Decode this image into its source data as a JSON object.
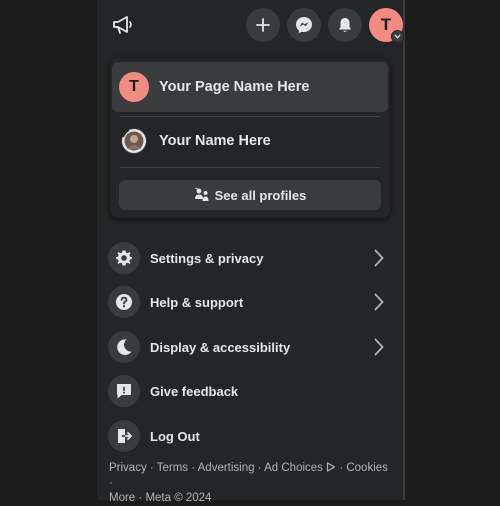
{
  "topbar": {
    "avatar_initial": "T"
  },
  "profiles": {
    "active": {
      "initial": "T",
      "name": "Your Page Name Here"
    },
    "second": {
      "name": "Your Name Here"
    },
    "see_all_label": "See all profiles"
  },
  "menu": {
    "items": [
      {
        "label": "Settings & privacy",
        "icon": "gear-icon",
        "has_chevron": true
      },
      {
        "label": "Help & support",
        "icon": "question-icon",
        "has_chevron": true
      },
      {
        "label": "Display & accessibility",
        "icon": "moon-icon",
        "has_chevron": true
      },
      {
        "label": "Give feedback",
        "icon": "feedback-icon",
        "has_chevron": false
      },
      {
        "label": "Log Out",
        "icon": "logout-icon",
        "has_chevron": false
      }
    ]
  },
  "footer": {
    "privacy": "Privacy",
    "terms": "Terms",
    "advertising": "Advertising",
    "ad_choices": "Ad Choices",
    "cookies": "Cookies",
    "more": "More",
    "copyright": "Meta © 2024",
    "separator": " · "
  },
  "colors": {
    "panel_bg": "#242526",
    "outer_bg": "#1c1c1d",
    "button_bg": "#3a3b3c",
    "avatar": "#f28b82",
    "text_primary": "#e4e6eb",
    "text_secondary": "#b0b3b8"
  }
}
